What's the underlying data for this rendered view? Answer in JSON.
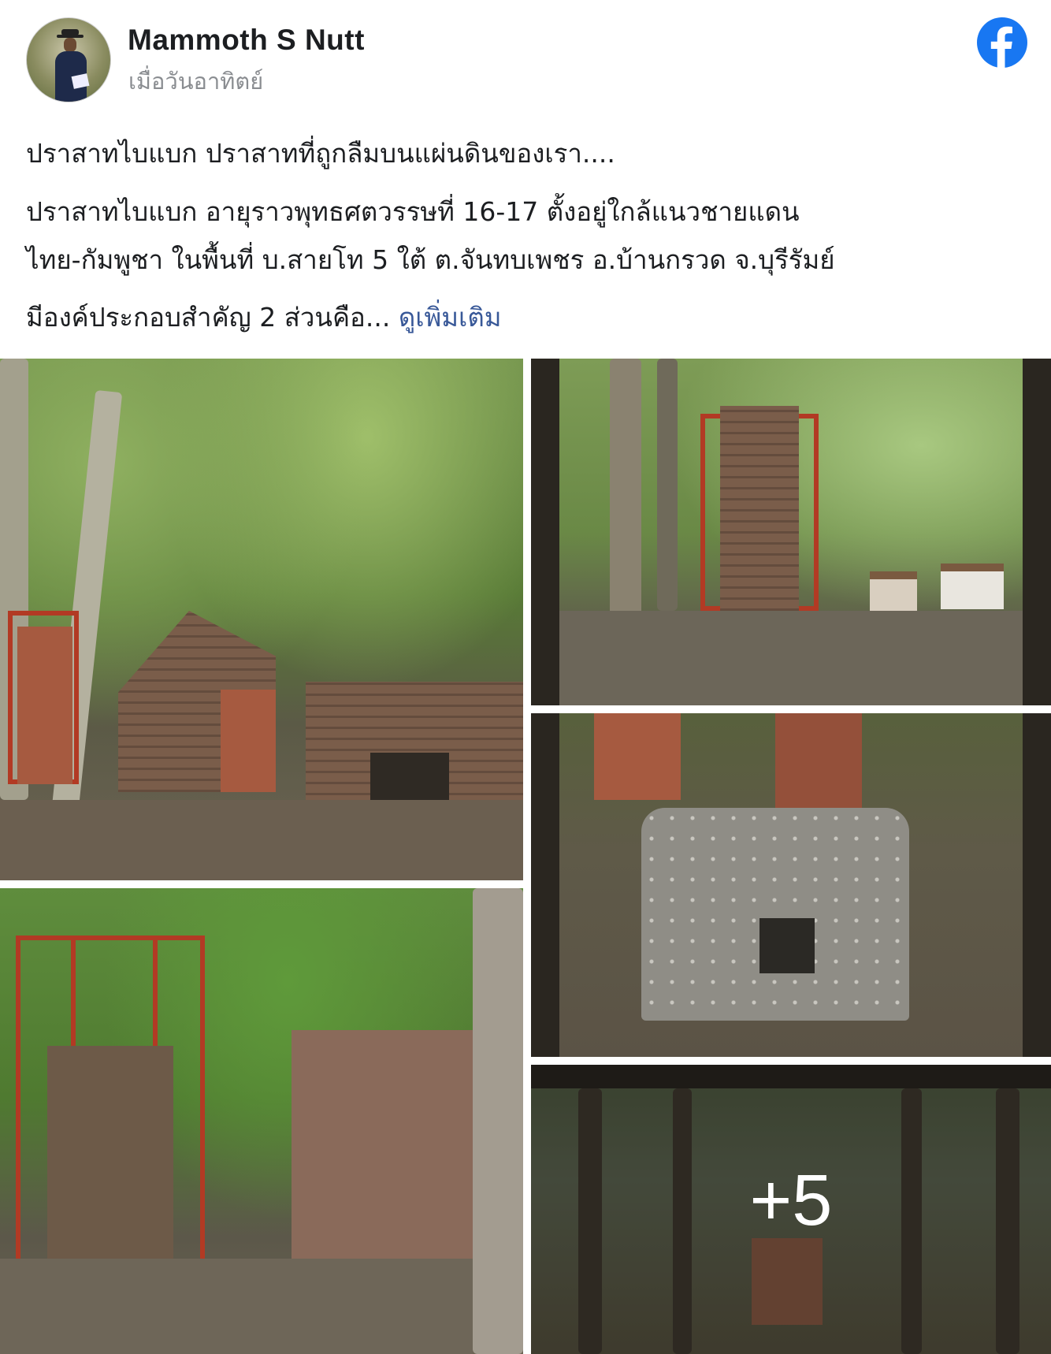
{
  "author": {
    "name": "Mammoth S Nutt",
    "time": "เมื่อวันอาทิตย์"
  },
  "post": {
    "title_line": "ปราสาทไบแบก ปราสาทที่ถูกลืมบนแผ่นดินของเรา....",
    "body_line1": "ปราสาทไบแบก อายุราวพุทธศตวรรษที่ 16-17 ตั้งอยู่ใกล้แนวชายแดน",
    "body_line2": "ไทย-กัมพูชา ในพื้นที่ บ.สายโท 5 ใต้ ต.จันทบเพชร อ.บ้านกรวด จ.บุรีรัมย์",
    "body_line3": "มีองค์ประกอบสำคัญ 2 ส่วนคือ...",
    "see_more": "ดูเพิ่มเติม"
  },
  "photos": {
    "more_count": "+5"
  },
  "colors": {
    "facebook_blue": "#1877f2",
    "link_blue": "#385898"
  }
}
